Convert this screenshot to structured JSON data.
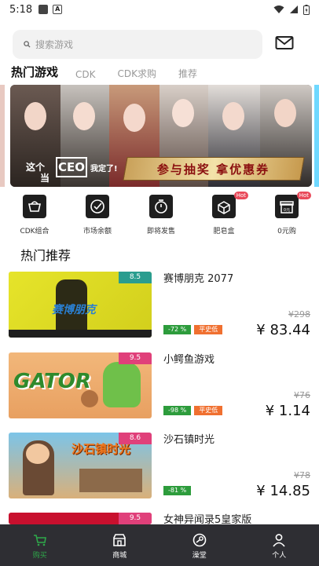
{
  "status": {
    "time": "5:18"
  },
  "search": {
    "placeholder": "搜索游戏"
  },
  "tabs": [
    "热门游戏",
    "CDK",
    "CDK求购",
    "推荐"
  ],
  "banner": {
    "caption": "参与抽奖 拿优惠券",
    "left_text": "这个",
    "left_text2": "当",
    "ceo": "CEO",
    "right_text": "我定了!"
  },
  "categories": [
    {
      "label": "CDK组合",
      "icon": "basket-icon"
    },
    {
      "label": "市场余额",
      "icon": "rocket-icon"
    },
    {
      "label": "即将发售",
      "icon": "stopwatch-icon"
    },
    {
      "label": "肥皂盒",
      "icon": "soapbox-icon",
      "hot": "Hot"
    },
    {
      "label": "0元购",
      "icon": "gift-icon",
      "hot": "Hot"
    }
  ],
  "section_title": "热门推荐",
  "games": [
    {
      "name": "赛博朋克 2077",
      "score": "8.5",
      "score_color": "#2a9d8f",
      "original_price": "¥298",
      "price": "¥ 83.44",
      "discount": "-72 %",
      "tag": "平史低",
      "logo_text": "赛博朋克"
    },
    {
      "name": "小鳄鱼游戏",
      "score": "9.5",
      "score_color": "#e0407a",
      "original_price": "¥76",
      "price": "¥ 1.14",
      "discount": "-98 %",
      "tag": "平史低",
      "logo_text": "GATOR"
    },
    {
      "name": "沙石镇时光",
      "score": "8.6",
      "score_color": "#e0407a",
      "original_price": "¥78",
      "price": "¥ 14.85",
      "discount": "-81 %",
      "tag": "",
      "logo_text": "沙石镇时光"
    },
    {
      "name": "女神异闻录5皇家版",
      "score": "9.5",
      "score_color": "#e0407a",
      "original_price": "",
      "price": "",
      "discount": "",
      "tag": "",
      "logo_text": ""
    }
  ],
  "nav": [
    {
      "label": "购买",
      "icon": "cart-icon",
      "active": true
    },
    {
      "label": "商城",
      "icon": "store-icon",
      "active": false
    },
    {
      "label": "澡堂",
      "icon": "steam-icon",
      "active": false
    },
    {
      "label": "个人",
      "icon": "person-icon",
      "active": false
    }
  ],
  "colors": {
    "accent": "#2ea84a",
    "discount_green": "#2d9c3c",
    "tag_orange": "#f07030",
    "nav_bg": "#2e2e33"
  }
}
